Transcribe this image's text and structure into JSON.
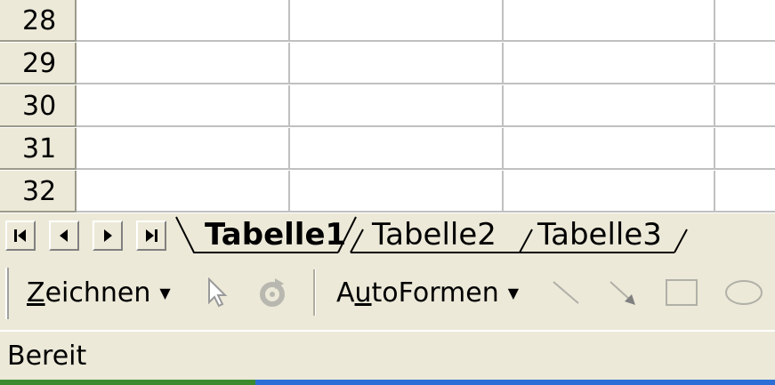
{
  "grid": {
    "rows": [
      "28",
      "29",
      "30",
      "31",
      "32"
    ]
  },
  "sheet_tabs": {
    "nav": [
      "first-sheet-icon",
      "previous-sheet-icon",
      "next-sheet-icon",
      "last-sheet-icon"
    ],
    "tabs": [
      "Tabelle1",
      "Tabelle2",
      "Tabelle3"
    ],
    "active": "Tabelle1"
  },
  "drawing_toolbar": {
    "draw_menu": {
      "underlined": "Z",
      "rest": "eichnen"
    },
    "autoshapes_menu": {
      "before": "A",
      "underlined": "u",
      "rest": "toFormen"
    },
    "icons": [
      "select-objects-icon",
      "free-rotate-icon",
      "line-icon",
      "arrow-icon",
      "rectangle-icon",
      "oval-icon"
    ]
  },
  "status": {
    "text": "Bereit"
  }
}
